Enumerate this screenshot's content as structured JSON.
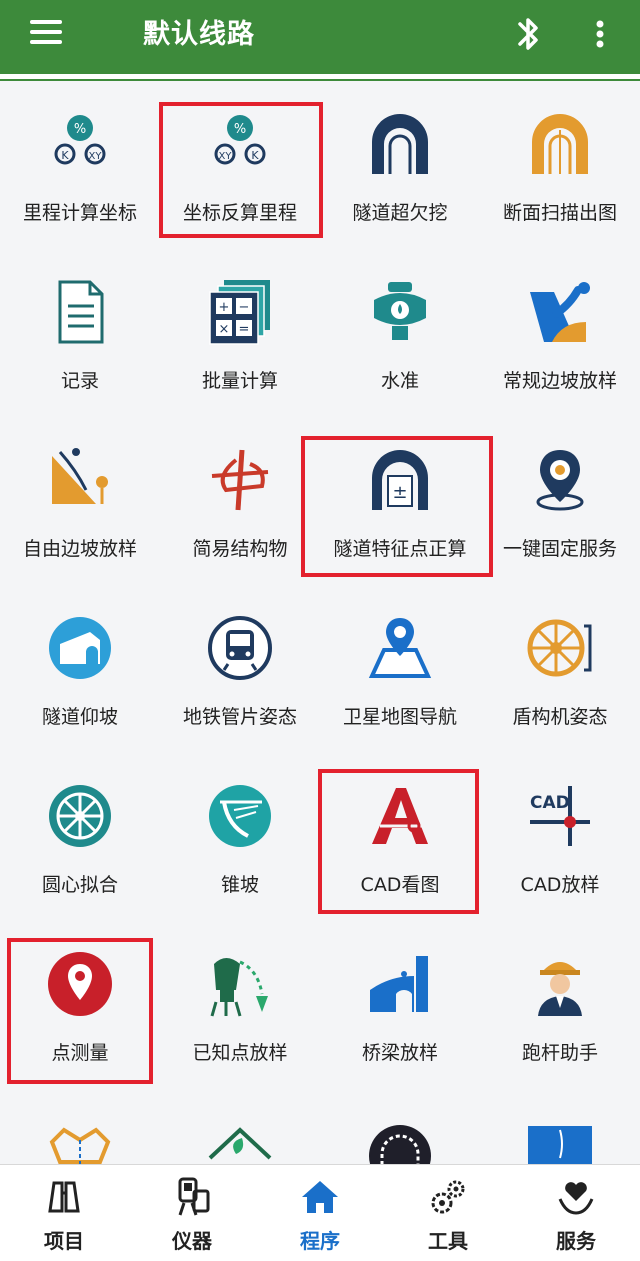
{
  "appbar": {
    "title": "默认线路",
    "menu_icon": "hamburger-menu-icon",
    "bluetooth_icon": "bluetooth-icon",
    "more_icon": "more-vertical-icon"
  },
  "programs": [
    {
      "label": "里程计算坐标",
      "icon": "mileage-to-coordinate-icon"
    },
    {
      "label": "坐标反算里程",
      "icon": "coordinate-to-mileage-icon"
    },
    {
      "label": "隧道超欠挖",
      "icon": "tunnel-overbreak-icon"
    },
    {
      "label": "断面扫描出图",
      "icon": "section-scan-icon"
    },
    {
      "label": "记录",
      "icon": "record-document-icon"
    },
    {
      "label": "批量计算",
      "icon": "batch-calculator-icon"
    },
    {
      "label": "水准",
      "icon": "level-instrument-icon"
    },
    {
      "label": "常规边坡放样",
      "icon": "slope-stakeout-icon"
    },
    {
      "label": "自由边坡放样",
      "icon": "free-slope-stakeout-icon"
    },
    {
      "label": "简易结构物",
      "icon": "simple-structure-icon"
    },
    {
      "label": "隧道特征点正算",
      "icon": "tunnel-feature-point-icon"
    },
    {
      "label": "一键固定服务",
      "icon": "location-pin-icon"
    },
    {
      "label": "隧道仰坡",
      "icon": "tunnel-slope-icon"
    },
    {
      "label": "地铁管片姿态",
      "icon": "metro-train-icon"
    },
    {
      "label": "卫星地图导航",
      "icon": "satellite-map-icon"
    },
    {
      "label": "盾构机姿态",
      "icon": "shield-machine-icon"
    },
    {
      "label": "圆心拟合",
      "icon": "circle-fit-icon"
    },
    {
      "label": "锥坡",
      "icon": "cone-slope-icon"
    },
    {
      "label": "CAD看图",
      "icon": "cad-viewer-icon"
    },
    {
      "label": "CAD放样",
      "icon": "cad-stakeout-icon"
    },
    {
      "label": "点测量",
      "icon": "point-measure-pin-icon"
    },
    {
      "label": "已知点放样",
      "icon": "known-point-stakeout-icon"
    },
    {
      "label": "桥梁放样",
      "icon": "bridge-stakeout-icon"
    },
    {
      "label": "跑杆助手",
      "icon": "worker-helmet-icon"
    }
  ],
  "tabs": [
    {
      "label": "项目",
      "icon": "binoculars-icon",
      "active": false
    },
    {
      "label": "仪器",
      "icon": "instrument-icon",
      "active": false
    },
    {
      "label": "程序",
      "icon": "home-icon",
      "active": true
    },
    {
      "label": "工具",
      "icon": "gears-icon",
      "active": false
    },
    {
      "label": "服务",
      "icon": "heart-hand-icon",
      "active": false
    }
  ],
  "colors": {
    "appbar": "#3d8a3b",
    "highlight": "#e3212e",
    "active_tab": "#1a6fc9",
    "icon_navy": "#1f3a5f",
    "icon_teal": "#1f8a8c",
    "icon_orange": "#e39b2f"
  }
}
